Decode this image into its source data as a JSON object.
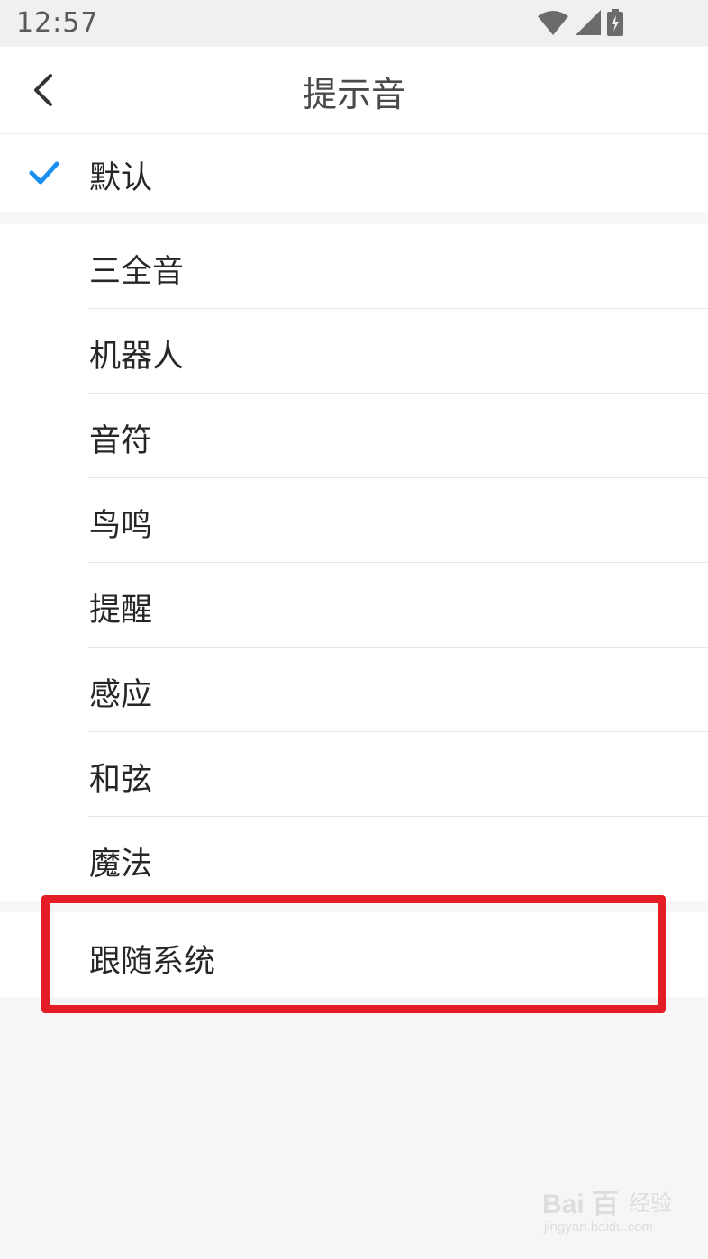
{
  "status_bar": {
    "time": "12:57",
    "icons": [
      "wifi-icon",
      "cell-signal-icon",
      "battery-charging-icon"
    ]
  },
  "header": {
    "title": "提示音",
    "back_icon": "chevron-left-icon"
  },
  "selected_option": {
    "label": "默认",
    "check_icon": "checkmark-icon",
    "check_color": "#1a8ff0"
  },
  "options": [
    {
      "label": "三全音"
    },
    {
      "label": "机器人"
    },
    {
      "label": "音符"
    },
    {
      "label": "鸟鸣"
    },
    {
      "label": "提醒"
    },
    {
      "label": "感应"
    },
    {
      "label": "和弦"
    },
    {
      "label": "魔法"
    }
  ],
  "follow_system": {
    "label": "跟随系统",
    "highlight_color": "#e31c25"
  },
  "watermark": {
    "brand": "Bai 百",
    "suffix": "经验",
    "url": "jingyan.baidu.com"
  }
}
